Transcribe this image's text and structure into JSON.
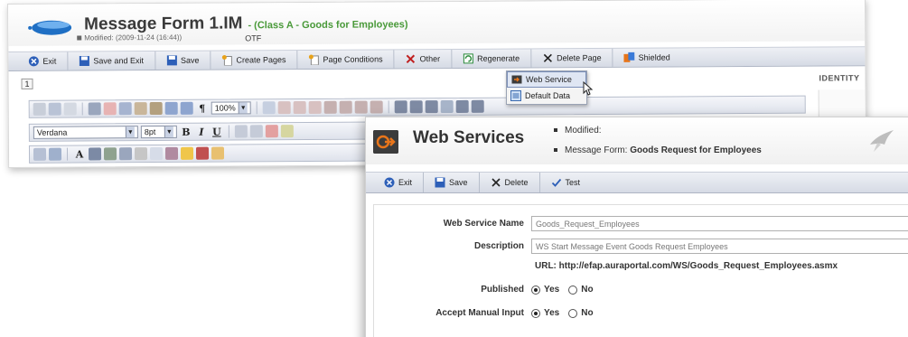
{
  "back_window": {
    "title": "Message Form 1.IM",
    "subtitle": "- (Class A - Goods for Employees)",
    "modified_label": "Modified:",
    "modified_value": "(2009-11-24 (16:44))",
    "otf": "OTF",
    "toolbar": [
      {
        "label": "Exit",
        "icon": "exit-icon",
        "name": "exit"
      },
      {
        "label": "Save and Exit",
        "icon": "save-icon",
        "name": "save-and-exit"
      },
      {
        "label": "Save",
        "icon": "save-icon",
        "name": "save"
      },
      {
        "label": "Create Pages",
        "icon": "create-pages-icon",
        "name": "create-pages"
      },
      {
        "label": "Page Conditions",
        "icon": "page-conditions-icon",
        "name": "page-conditions"
      },
      {
        "label": "Other",
        "icon": "other-icon",
        "name": "other"
      },
      {
        "label": "Regenerate",
        "icon": "regenerate-icon",
        "name": "regenerate"
      },
      {
        "label": "Delete Page",
        "icon": "delete-icon",
        "name": "delete-page"
      },
      {
        "label": "Shielded",
        "icon": "shielded-icon",
        "name": "shielded"
      }
    ],
    "page_tab": "1",
    "identity": "IDENTITY",
    "zoom": "100%",
    "font": "Verdana",
    "font_size": "8pt",
    "format_buttons": [
      "B",
      "I",
      "U"
    ]
  },
  "dropdown": {
    "items": [
      {
        "label": "Web Service",
        "icon": "web-service-icon",
        "highlighted": true
      },
      {
        "label": "Default Data",
        "icon": "default-data-icon",
        "highlighted": false
      }
    ]
  },
  "web_services": {
    "title": "Web Services",
    "modified_label": "Modified:",
    "message_form_label": "Message Form:",
    "message_form_value": "Goods Request for Employees",
    "toolbar": [
      {
        "label": "Exit",
        "icon": "exit-icon",
        "name": "exit"
      },
      {
        "label": "Save",
        "icon": "save-icon",
        "name": "save"
      },
      {
        "label": "Delete",
        "icon": "delete-icon",
        "name": "delete"
      },
      {
        "label": "Test",
        "icon": "check-icon",
        "name": "test"
      }
    ],
    "form": {
      "name_label": "Web Service Name",
      "name_value": "Goods_Request_Employees",
      "description_label": "Description",
      "description_value": "WS Start Message Event Goods Request Employees",
      "url": "URL: http://efap.auraportal.com/WS/Goods_Request_Employees.asmx",
      "published_label": "Published",
      "published_options": [
        "Yes",
        "No"
      ],
      "published_value": "Yes",
      "manual_input_label": "Accept Manual Input",
      "manual_input_options": [
        "Yes",
        "No"
      ],
      "manual_input_value": "Yes"
    }
  },
  "colors": {
    "subtitle": "#4a9a3a",
    "toolbar_bg": "#d6dbe5",
    "exit_icon": "#2d5fb8",
    "accent_orange": "#e8751a"
  }
}
